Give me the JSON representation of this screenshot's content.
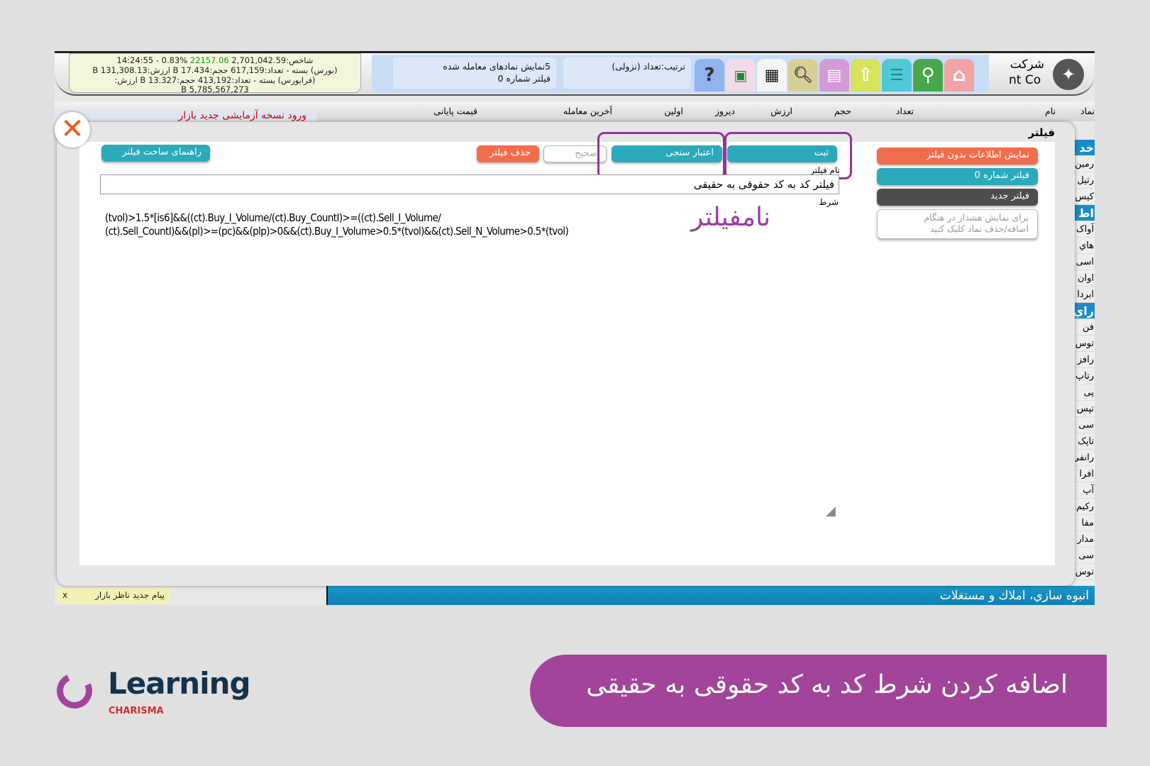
{
  "topbar": {
    "index_line1_prefix": "شاخص:2,701,042.59",
    "index_value": "22157.06",
    "index_line1_suffix": "%0.83 - 14:24:55",
    "bourse_line": "(بورس) بسته - تعداد:617,159 حجم:17.434 B ارزش:131,308.13 B",
    "farabourse_line": "(فرابورس) بسته - تعداد:413,192 حجم:13.327 B ارزش:",
    "farabourse_value": "5,785,567,273 B",
    "info_line1": "5نمایش نمادهای معامله شده",
    "info_line2": "فیلتر شماره 0",
    "sort_text": "ترتیب:تعداد (نزولی)",
    "company_line1": "شرکت",
    "company_line2": "nt Co",
    "tools": [
      "help-icon",
      "excel-icon",
      "grid-icon",
      "preview-icon",
      "calendar-icon",
      "upload-icon",
      "list-icon",
      "search-icon",
      "home-icon"
    ]
  },
  "header": {
    "columns": [
      "نماد",
      "نام",
      "تعداد",
      "حجم",
      "ارزش",
      "دیروز",
      "اولین",
      "آخرین معامله",
      "قیمت پایانی"
    ]
  },
  "background": {
    "notice": "ورود   نسخه آزمایشی جدید بازار",
    "right_list": [
      "خد",
      "رمین",
      "رتیل",
      "کیس",
      "اط",
      "آواک",
      "هاي",
      "اسی",
      "اوان",
      "ابردا",
      "راي",
      "فن",
      "توس",
      "رافز",
      "رتاپ",
      "پی",
      "تپس",
      "سی",
      "تاپک",
      "رانفی",
      "افرا",
      "آپ",
      "رکیم",
      "مفا",
      "مدار",
      "سی",
      "توس"
    ],
    "bottom_sector": "انبوه سازي، املاك و مستغلات",
    "market_message": "پیام جدید ناظر بازار",
    "market_message_close": "x"
  },
  "dialog": {
    "title": "فیلتر",
    "close_icon": "close-x-icon",
    "save_label": "ثبت",
    "validate_label": "اعتبار سنجی",
    "valid_status": "صحیح",
    "delete_label": "حذف فیلتر",
    "guide_label": "راهنمای ساخت فیلتر",
    "name_label": "نام فیلتر",
    "name_value": "فیلتر کد به کد حقوقی به حقیقی",
    "condition_label": "شرط",
    "condition_line1": "(tvol)>1.5*[is6]&&((ct).Buy_I_Volume/(ct).Buy_CountI)>=((ct).Sell_I_Volume/",
    "condition_line2": "(ct).Sell_CountI)&&(pl)>=(pc)&&(plp)>0&&(ct).Buy_I_Volume>0.5*(tvol)&&(ct).Sell_N_Volume>0.5*(tvol)",
    "annotation": "نامفیلتر",
    "side_buttons": {
      "show_unfiltered": "نمایش اطلاعات بدون فیلتر",
      "filter_0": "فیلتر شماره 0",
      "new_filter": "فیلتر جدید",
      "warning_line1": "برای نمایش هشدار در هنگام",
      "warning_line2": "اضافه/حذف نماد کلیک کنید"
    }
  },
  "footer": {
    "logo_word": "Learning",
    "logo_sub": "CHARISMA",
    "banner": "اضافه کردن شرط کد به کد حقوقی به حقیقی"
  },
  "colors": {
    "accent_purple": "#a2449a",
    "teal": "#2aaabb",
    "orange": "#f26d4b",
    "dark": "#4d4d4d",
    "logo_navy": "#16324a",
    "logo_red": "#d32f2f"
  }
}
